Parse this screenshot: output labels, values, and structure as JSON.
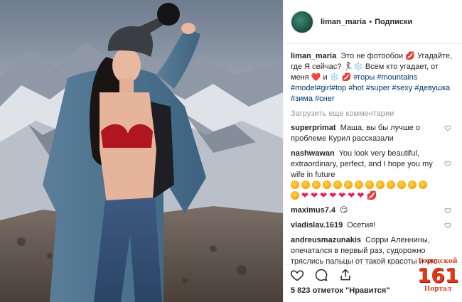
{
  "post": {
    "username": "liman_maria",
    "dot": "•",
    "follow_label": "Подписки"
  },
  "caption": {
    "username": "liman_maria",
    "text_before": "Это не фотообои 💋 Угадайте, где Я сейчас? 🏃‍♀️❄️ Всем кто угадает, от меня ❤️ и ❄️ 💋",
    "hashtags": [
      "#горы",
      "#mountains",
      "#model",
      "#girl",
      "#top",
      "#hot",
      "#super",
      "#sexy",
      "#девушка",
      "#зима",
      "#снег"
    ]
  },
  "load_more_label": "Загрузить еще комментарии",
  "comments": [
    {
      "username": "superprimat",
      "text": "Маша, вы бы лучше о проблеме Курил рассказали"
    },
    {
      "username": "nashwawan",
      "text": "You look very beautiful, extraordinary, perfect, and I hope you my wife in future",
      "emoji_faces": 14,
      "emoji_hearts": 7,
      "trailing": "💋"
    },
    {
      "username": "maximus7.4",
      "text": "😏"
    },
    {
      "username": "vladislav.1619",
      "text": "Осетия!"
    },
    {
      "username": "andreusmazunakis",
      "text": "Сорри Аленнины, опечатался в первый раз, судорожно тряслись пальцы от такой красоты и что самое"
    }
  ],
  "actions": {
    "like_icon": "heart-outline-icon",
    "comment_icon": "speech-bubble-icon",
    "share_icon": "share-icon",
    "save_icon": "bookmark-icon"
  },
  "likes_text": "5 823 отметок \"Нравится\"",
  "watermark": {
    "top": "Городской",
    "number": "161",
    "bottom": "Портал"
  },
  "colors": {
    "hashtag": "#003569",
    "muted": "#999999",
    "text": "#262626",
    "heart": "#e0245e",
    "watermark": "#e03a1c"
  }
}
